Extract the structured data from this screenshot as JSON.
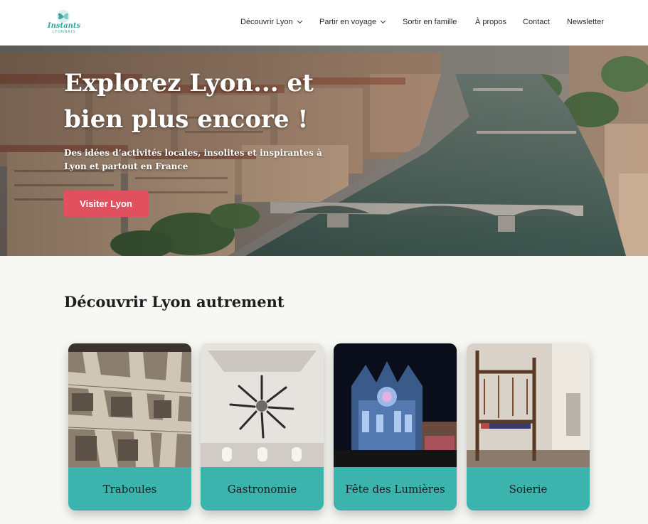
{
  "brand": {
    "name": "Instants",
    "tagline": "LYONNAIS"
  },
  "nav": [
    {
      "label": "Découvrir Lyon",
      "dropdown": true
    },
    {
      "label": "Partir en voyage",
      "dropdown": true
    },
    {
      "label": "Sortir en famille",
      "dropdown": false
    },
    {
      "label": "À propos",
      "dropdown": false
    },
    {
      "label": "Contact",
      "dropdown": false
    },
    {
      "label": "Newsletter",
      "dropdown": false
    }
  ],
  "hero": {
    "title_line1": "Explorez Lyon... et",
    "title_line2": "bien plus encore !",
    "subtitle": "Des idées d’activités locales, insolites et inspirantes à Lyon et partout en France",
    "button": "Visiter Lyon",
    "button_color": "#e0505f"
  },
  "section": {
    "title": "Découvrir Lyon autrement",
    "cards": [
      {
        "label": "Traboules"
      },
      {
        "label": "Gastronomie"
      },
      {
        "label": "Fête des Lumières"
      },
      {
        "label": "Soierie"
      }
    ]
  },
  "colors": {
    "accent": "#3cb4ae",
    "brand": "#3aa6a0",
    "background": "#f7f7f3"
  },
  "icons": {
    "logo": "butterfly-logo-icon",
    "dropdown": "chevron-down-icon"
  }
}
